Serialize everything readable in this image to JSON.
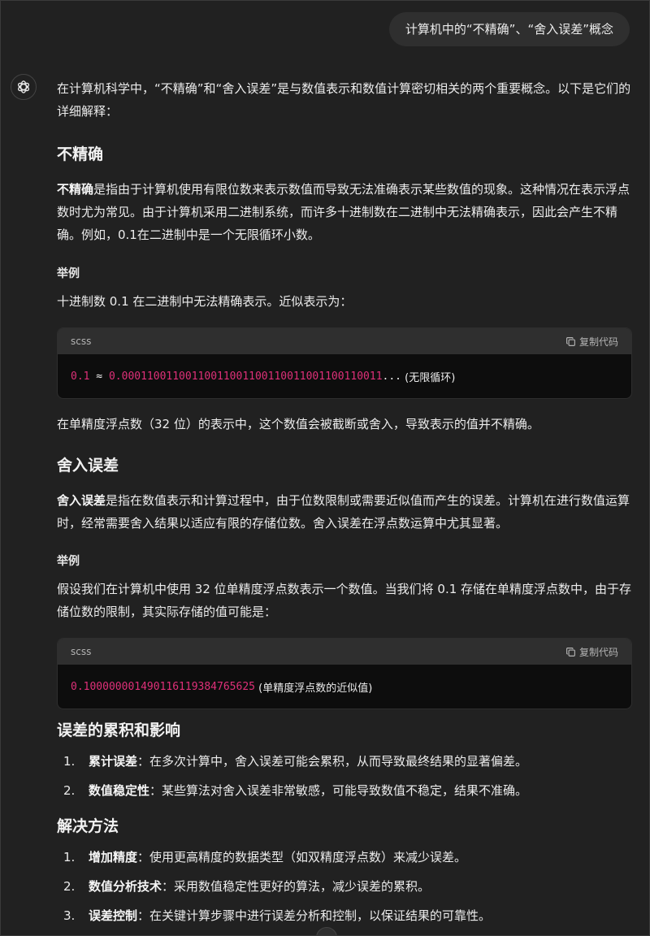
{
  "user_message": "计算机中的“不精确”、“舍入误差”概念",
  "icons": {
    "assistant_avatar": "openai-logo-icon",
    "copy": "copy-icon"
  },
  "colors": {
    "background": "#212121",
    "code_number": "#df3079",
    "user_bubble": "#2f2f2f"
  },
  "answer": {
    "intro": "在计算机科学中，“不精确”和“舍入误差”是与数值表示和数值计算密切相关的两个重要概念。以下是它们的详细解释：",
    "section1": {
      "title": "不精确",
      "term": "不精确",
      "body": "是指由于计算机使用有限位数来表示数值而导致无法准确表示某些数值的现象。这种情况在表示浮点数时尤为常见。由于计算机采用二进制系统，而许多十进制数在二进制中无法精确表示，因此会产生不精确。例如，0.1在二进制中是一个无限循环小数。",
      "example_title": "举例",
      "example_text": "十进制数 0.1 在二进制中无法精确表示。近似表示为：",
      "code": {
        "lang": "scss",
        "copy_label": "复制代码",
        "num1": "0.1",
        "op": " ≈ ",
        "num2": "0.00011001100110011001100110011001100110011",
        "dots": "...",
        "comment": " (无限循环)"
      },
      "after": "在单精度浮点数（32 位）的表示中，这个数值会被截断或舍入，导致表示的值并不精确。"
    },
    "section2": {
      "title": "舍入误差",
      "term": "舍入误差",
      "body": "是指在数值表示和计算过程中，由于位数限制或需要近似值而产生的误差。计算机在进行数值运算时，经常需要舍入结果以适应有限的存储位数。舍入误差在浮点数运算中尤其显著。",
      "example_title": "举例",
      "example_text": "假设我们在计算机中使用 32 位单精度浮点数表示一个数值。当我们将 0.1 存储在单精度浮点数中，由于存储位数的限制，其实际存储的值可能是：",
      "code": {
        "lang": "scss",
        "copy_label": "复制代码",
        "num": "0.100000001490116119384765625",
        "comment": " (单精度浮点数的近似值)"
      }
    },
    "section3": {
      "title": "误差的累积和影响",
      "items": [
        {
          "n": "1.",
          "term": "累计误差",
          "text": "：在多次计算中，舍入误差可能会累积，从而导致最终结果的显著偏差。"
        },
        {
          "n": "2.",
          "term": "数值稳定性",
          "text": "：某些算法对舍入误差非常敏感，可能导致数值不稳定，结果不准确。"
        }
      ]
    },
    "section4": {
      "title": "解决方法",
      "items": [
        {
          "n": "1.",
          "term": "增加精度",
          "text": "：使用更高精度的数据类型（如双精度浮点数）来减少误差。"
        },
        {
          "n": "2.",
          "term": "数值分析技术",
          "text": "：采用数值稳定性更好的算法，减少误差的累积。"
        },
        {
          "n": "3.",
          "term": "误差控制",
          "text": "：在关键计算步骤中进行误差分析和控制，以保证结果的可靠性。"
        }
      ]
    }
  }
}
